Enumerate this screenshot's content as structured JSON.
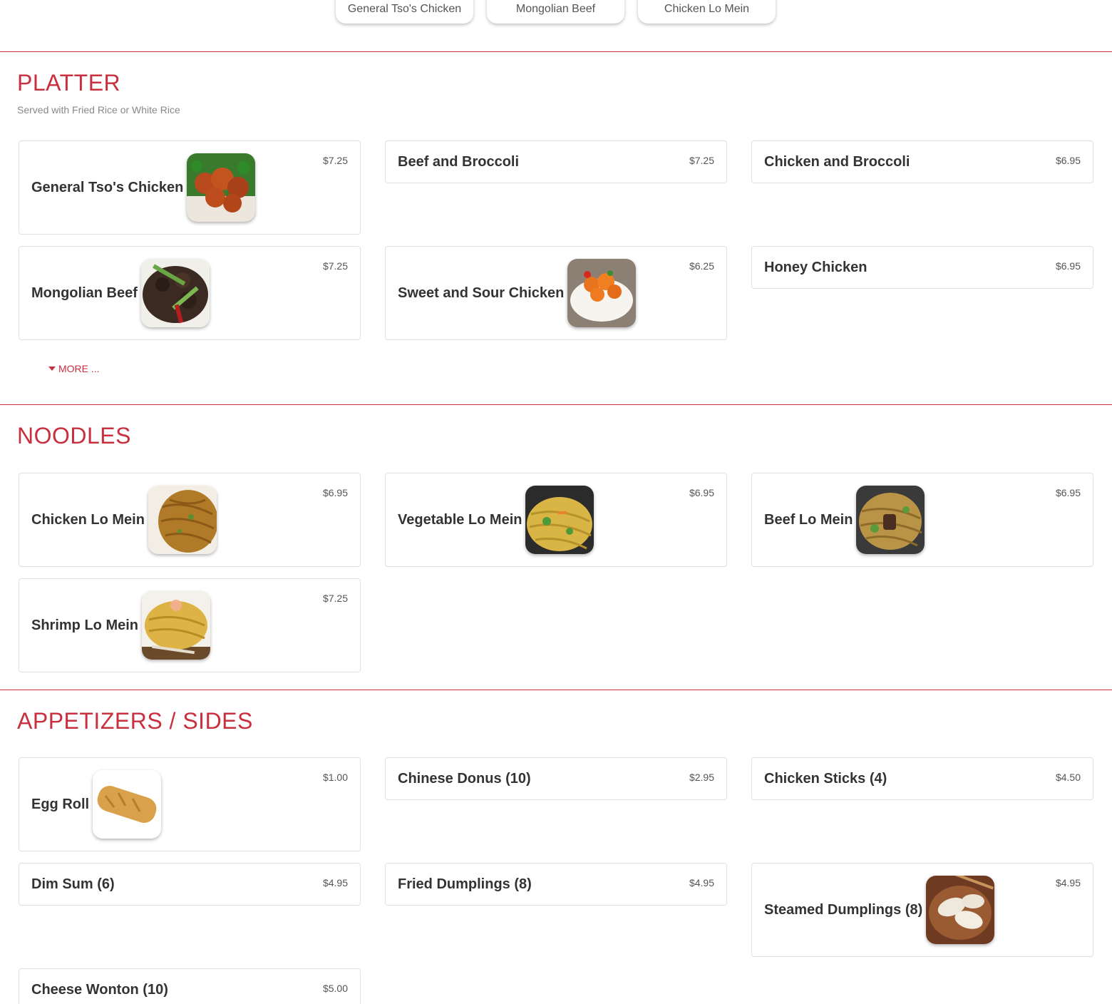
{
  "top_tabs": [
    "General Tso's Chicken",
    "Mongolian Beef",
    "Chicken Lo Mein"
  ],
  "sections": {
    "platter": {
      "title": "PLATTER",
      "subtitle": "Served with Fried Rice or White Rice",
      "more_label": "MORE ...",
      "items": [
        {
          "name": "General Tso's Chicken",
          "price": "$7.25"
        },
        {
          "name": "Beef and Broccoli",
          "price": "$7.25"
        },
        {
          "name": "Chicken and Broccoli",
          "price": "$6.95"
        },
        {
          "name": "Mongolian Beef",
          "price": "$7.25"
        },
        {
          "name": "Sweet and Sour Chicken",
          "price": "$6.25"
        },
        {
          "name": "Honey Chicken",
          "price": "$6.95"
        }
      ]
    },
    "noodles": {
      "title": "NOODLES",
      "items": [
        {
          "name": "Chicken Lo Mein",
          "price": "$6.95"
        },
        {
          "name": "Vegetable Lo Mein",
          "price": "$6.95"
        },
        {
          "name": "Beef Lo Mein",
          "price": "$6.95"
        },
        {
          "name": "Shrimp Lo Mein",
          "price": "$7.25"
        }
      ]
    },
    "appetizers": {
      "title": "APPETIZERS / SIDES",
      "items": [
        {
          "name": "Egg Roll",
          "price": "$1.00"
        },
        {
          "name": "Chinese Donus (10)",
          "price": "$2.95"
        },
        {
          "name": "Chicken Sticks (4)",
          "price": "$4.50"
        },
        {
          "name": "Dim Sum (6)",
          "price": "$4.95"
        },
        {
          "name": "Fried Dumplings (8)",
          "price": "$4.95"
        },
        {
          "name": "Steamed Dumplings (8)",
          "price": "$4.95"
        },
        {
          "name": "Cheese Wonton (10)",
          "price": "$5.00"
        }
      ]
    }
  },
  "colors": {
    "accent": "#c8303f"
  }
}
